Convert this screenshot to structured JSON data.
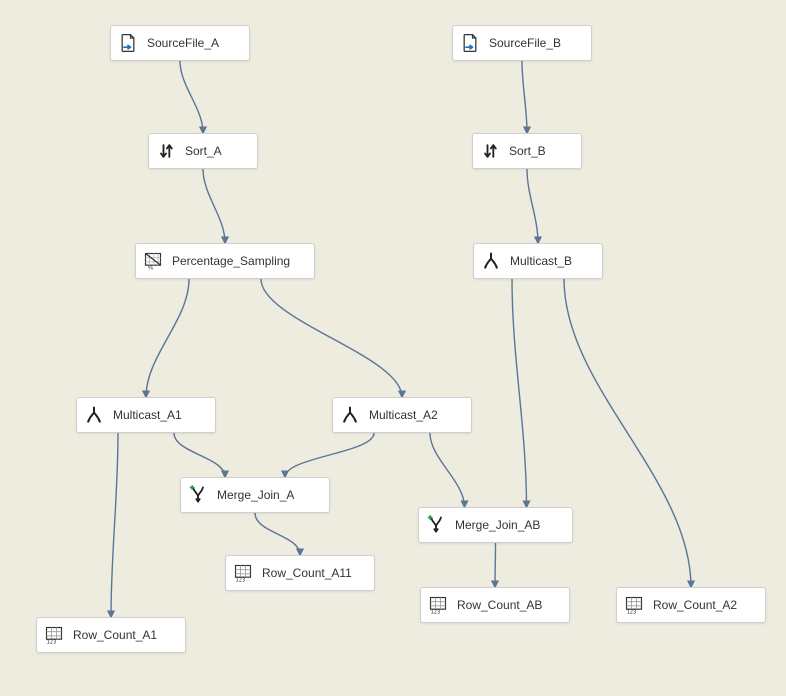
{
  "nodes": {
    "sourceA": {
      "label": "SourceFile_A",
      "icon": "file-source-icon"
    },
    "sourceB": {
      "label": "SourceFile_B",
      "icon": "file-source-icon"
    },
    "sortA": {
      "label": "Sort_A",
      "icon": "sort-icon"
    },
    "sortB": {
      "label": "Sort_B",
      "icon": "sort-icon"
    },
    "pctSamp": {
      "label": "Percentage_Sampling",
      "icon": "sampling-icon"
    },
    "multiB": {
      "label": "Multicast_B",
      "icon": "multicast-icon"
    },
    "multiA1": {
      "label": "Multicast_A1",
      "icon": "multicast-icon"
    },
    "multiA2": {
      "label": "Multicast_A2",
      "icon": "multicast-icon"
    },
    "mergeA": {
      "label": "Merge_Join_A",
      "icon": "merge-join-icon"
    },
    "mergeAB": {
      "label": "Merge_Join_AB",
      "icon": "merge-join-icon"
    },
    "rcA11": {
      "label": "Row_Count_A11",
      "icon": "row-count-icon"
    },
    "rcA1": {
      "label": "Row_Count_A1",
      "icon": "row-count-icon"
    },
    "rcAB": {
      "label": "Row_Count_AB",
      "icon": "row-count-icon"
    },
    "rcA2": {
      "label": "Row_Count_A2",
      "icon": "row-count-icon"
    }
  },
  "edges": [
    {
      "from": "sourceA",
      "to": "sortA"
    },
    {
      "from": "sortA",
      "to": "pctSamp"
    },
    {
      "from": "sourceB",
      "to": "sortB"
    },
    {
      "from": "sortB",
      "to": "multiB"
    },
    {
      "from": "pctSamp",
      "to": "multiA1",
      "fromPort": "left"
    },
    {
      "from": "pctSamp",
      "to": "multiA2",
      "fromPort": "right"
    },
    {
      "from": "multiA1",
      "to": "rcA1",
      "fromPort": "left"
    },
    {
      "from": "multiA1",
      "to": "mergeA",
      "fromPort": "right",
      "toPort": "left"
    },
    {
      "from": "multiA2",
      "to": "mergeA",
      "fromPort": "left",
      "toPort": "right"
    },
    {
      "from": "multiA2",
      "to": "mergeAB",
      "fromPort": "right",
      "toPort": "left"
    },
    {
      "from": "multiB",
      "to": "mergeAB",
      "fromPort": "left",
      "toPort": "right"
    },
    {
      "from": "multiB",
      "to": "rcA2",
      "fromPort": "right"
    },
    {
      "from": "mergeA",
      "to": "rcA11"
    },
    {
      "from": "mergeAB",
      "to": "rcAB"
    }
  ]
}
